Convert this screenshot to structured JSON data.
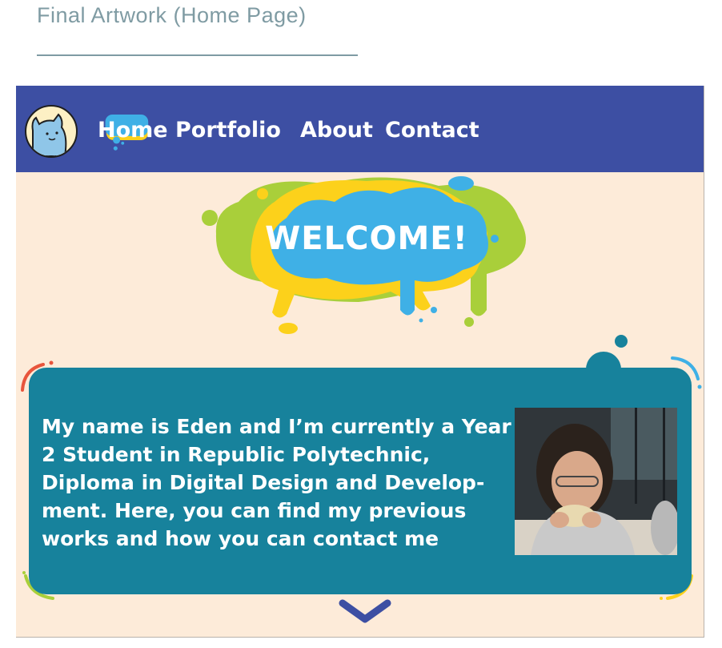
{
  "page": {
    "heading": "Final Artwork (Home Page)"
  },
  "nav": {
    "items": [
      {
        "label": "Home",
        "active": true
      },
      {
        "label": "Portfolio",
        "active": false
      },
      {
        "label": "About",
        "active": false
      },
      {
        "label": "Contact",
        "active": false
      }
    ],
    "avatar_icon": "cat-avatar-icon"
  },
  "hero": {
    "welcome": "WELCOME!"
  },
  "intro": {
    "text": "My name is Eden and I’m currently a Year 2 Student in Republic Polytechnic, Diploma in Digital Design and Develop-ment. Here, you can find my previous works and how you can contact me"
  },
  "colors": {
    "navbar": "#3d4fa3",
    "background": "#fdebd9",
    "card": "#17829c",
    "blue": "#3fb0e6",
    "yellow": "#fcd11b",
    "green": "#a9cf3a"
  }
}
